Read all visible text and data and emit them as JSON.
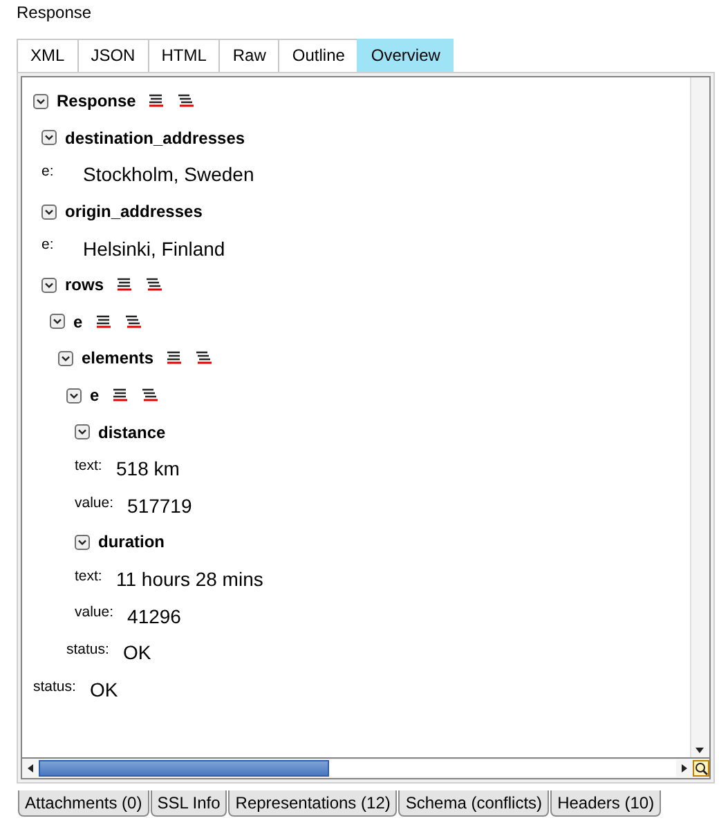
{
  "title": "Response",
  "tabs": [
    {
      "label": "XML",
      "selected": false
    },
    {
      "label": "JSON",
      "selected": false
    },
    {
      "label": "HTML",
      "selected": false
    },
    {
      "label": "Raw",
      "selected": false
    },
    {
      "label": "Outline",
      "selected": false
    },
    {
      "label": "Overview",
      "selected": true
    }
  ],
  "tree": [
    {
      "kind": "object",
      "label": "Response",
      "expanded": true,
      "list_icons": true,
      "children": [
        {
          "kind": "object",
          "label": "destination_addresses",
          "expanded": true,
          "list_icons": false,
          "children": [
            {
              "kind": "field",
              "label": "e:",
              "value": "Stockholm, Sweden"
            }
          ]
        },
        {
          "kind": "object",
          "label": "origin_addresses",
          "expanded": true,
          "list_icons": false,
          "children": [
            {
              "kind": "field",
              "label": "e:",
              "value": "Helsinki, Finland"
            }
          ]
        },
        {
          "kind": "object",
          "label": "rows",
          "expanded": true,
          "list_icons": true,
          "children": [
            {
              "kind": "object",
              "label": "e",
              "expanded": true,
              "list_icons": true,
              "children": [
                {
                  "kind": "object",
                  "label": "elements",
                  "expanded": true,
                  "list_icons": true,
                  "children": [
                    {
                      "kind": "object",
                      "label": "e",
                      "expanded": true,
                      "list_icons": true,
                      "children": [
                        {
                          "kind": "object",
                          "label": "distance",
                          "expanded": true,
                          "list_icons": false,
                          "children": [
                            {
                              "kind": "field",
                              "label": "text:",
                              "value": "518 km"
                            },
                            {
                              "kind": "field",
                              "label": "value:",
                              "value": "517719"
                            }
                          ]
                        },
                        {
                          "kind": "object",
                          "label": "duration",
                          "expanded": true,
                          "list_icons": false,
                          "children": [
                            {
                              "kind": "field",
                              "label": "text:",
                              "value": "11 hours 28 mins"
                            },
                            {
                              "kind": "field",
                              "label": "value:",
                              "value": "41296"
                            }
                          ]
                        },
                        {
                          "kind": "field",
                          "label": "status:",
                          "value": "OK"
                        }
                      ]
                    }
                  ]
                }
              ]
            }
          ]
        },
        {
          "kind": "field",
          "label": "status:",
          "value": "OK"
        }
      ]
    }
  ],
  "bottom_tabs": [
    {
      "label": "Attachments (0)"
    },
    {
      "label": "SSL Info"
    },
    {
      "label": "Representations (12)"
    },
    {
      "label": "Schema (conflicts)"
    },
    {
      "label": "Headers (10)"
    }
  ]
}
